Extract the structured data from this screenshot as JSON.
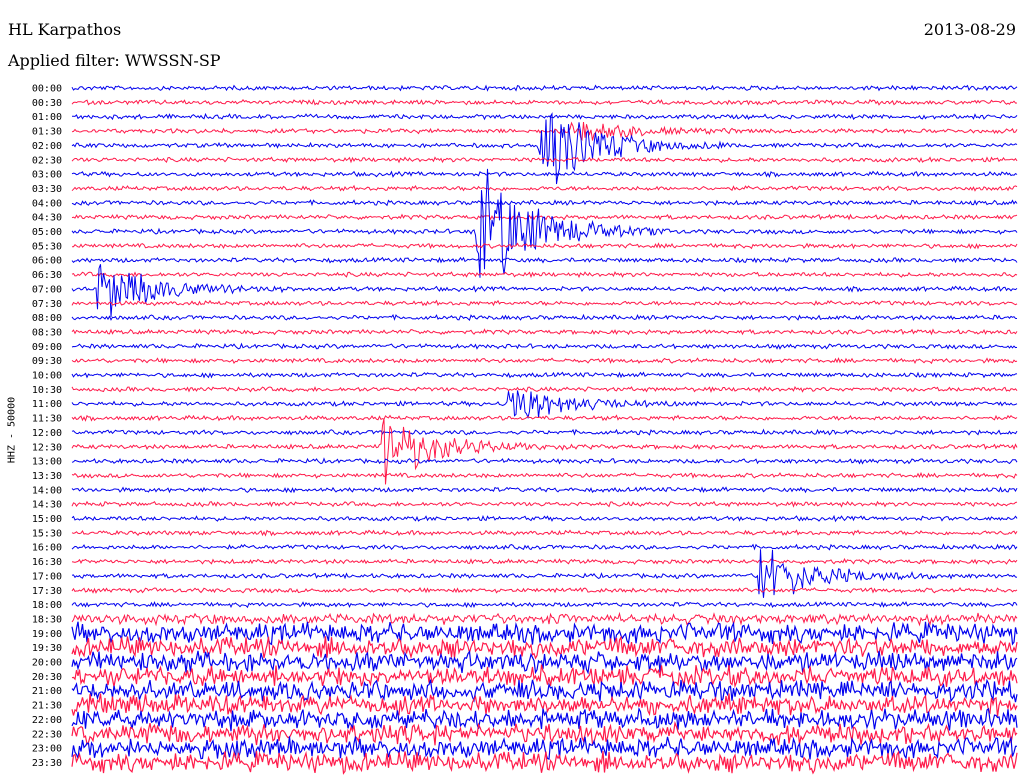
{
  "header": {
    "station": "HL Karpathos",
    "filter": "Applied filter: WWSSN-SP",
    "date": "2013-08-29"
  },
  "chart_data": {
    "type": "line",
    "title": "HL Karpathos",
    "date": "2013-08-29",
    "filter": "WWSSN-SP",
    "ylabel": "HHZ - 50000",
    "row_labels": [
      "00:00",
      "00:30",
      "01:00",
      "01:30",
      "02:00",
      "02:30",
      "03:00",
      "03:30",
      "04:00",
      "04:30",
      "05:00",
      "05:30",
      "06:00",
      "06:30",
      "07:00",
      "07:30",
      "08:00",
      "08:30",
      "09:00",
      "09:30",
      "10:00",
      "10:30",
      "11:00",
      "11:30",
      "12:00",
      "12:30",
      "13:00",
      "13:30",
      "14:00",
      "14:30",
      "15:00",
      "15:30",
      "16:00",
      "16:30",
      "17:00",
      "17:30",
      "18:00",
      "18:30",
      "19:00",
      "19:30",
      "20:00",
      "20:30",
      "21:00",
      "21:30",
      "22:00",
      "22:30",
      "23:00",
      "23:30"
    ],
    "trace_colors": [
      "#0000ee",
      "#ff1a4a"
    ],
    "minutes_per_row": 30,
    "events": [
      {
        "row": 3,
        "minute": 16,
        "amplitude": 1.0
      },
      {
        "row": 4,
        "minute": 15,
        "amplitude": 4.0
      },
      {
        "row": 10,
        "minute": 13,
        "amplitude": 6.0
      },
      {
        "row": 14,
        "minute": 1,
        "amplitude": 2.5
      },
      {
        "row": 22,
        "minute": 14,
        "amplitude": 1.8
      },
      {
        "row": 25,
        "minute": 10,
        "amplitude": 3.0
      },
      {
        "row": 34,
        "minute": 22,
        "amplitude": 2.5
      }
    ],
    "noise_onset_row": 38
  }
}
